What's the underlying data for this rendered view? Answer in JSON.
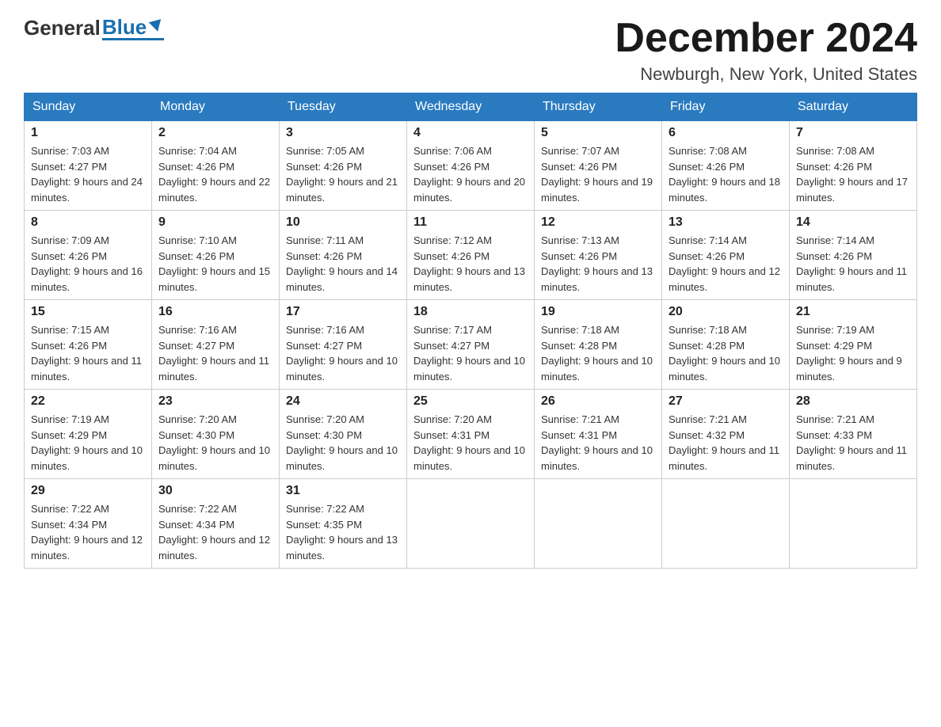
{
  "header": {
    "logo_general": "General",
    "logo_blue": "Blue",
    "title": "December 2024",
    "subtitle": "Newburgh, New York, United States"
  },
  "calendar": {
    "days_of_week": [
      "Sunday",
      "Monday",
      "Tuesday",
      "Wednesday",
      "Thursday",
      "Friday",
      "Saturday"
    ],
    "weeks": [
      [
        {
          "day": "1",
          "sunrise": "Sunrise: 7:03 AM",
          "sunset": "Sunset: 4:27 PM",
          "daylight": "Daylight: 9 hours and 24 minutes."
        },
        {
          "day": "2",
          "sunrise": "Sunrise: 7:04 AM",
          "sunset": "Sunset: 4:26 PM",
          "daylight": "Daylight: 9 hours and 22 minutes."
        },
        {
          "day": "3",
          "sunrise": "Sunrise: 7:05 AM",
          "sunset": "Sunset: 4:26 PM",
          "daylight": "Daylight: 9 hours and 21 minutes."
        },
        {
          "day": "4",
          "sunrise": "Sunrise: 7:06 AM",
          "sunset": "Sunset: 4:26 PM",
          "daylight": "Daylight: 9 hours and 20 minutes."
        },
        {
          "day": "5",
          "sunrise": "Sunrise: 7:07 AM",
          "sunset": "Sunset: 4:26 PM",
          "daylight": "Daylight: 9 hours and 19 minutes."
        },
        {
          "day": "6",
          "sunrise": "Sunrise: 7:08 AM",
          "sunset": "Sunset: 4:26 PM",
          "daylight": "Daylight: 9 hours and 18 minutes."
        },
        {
          "day": "7",
          "sunrise": "Sunrise: 7:08 AM",
          "sunset": "Sunset: 4:26 PM",
          "daylight": "Daylight: 9 hours and 17 minutes."
        }
      ],
      [
        {
          "day": "8",
          "sunrise": "Sunrise: 7:09 AM",
          "sunset": "Sunset: 4:26 PM",
          "daylight": "Daylight: 9 hours and 16 minutes."
        },
        {
          "day": "9",
          "sunrise": "Sunrise: 7:10 AM",
          "sunset": "Sunset: 4:26 PM",
          "daylight": "Daylight: 9 hours and 15 minutes."
        },
        {
          "day": "10",
          "sunrise": "Sunrise: 7:11 AM",
          "sunset": "Sunset: 4:26 PM",
          "daylight": "Daylight: 9 hours and 14 minutes."
        },
        {
          "day": "11",
          "sunrise": "Sunrise: 7:12 AM",
          "sunset": "Sunset: 4:26 PM",
          "daylight": "Daylight: 9 hours and 13 minutes."
        },
        {
          "day": "12",
          "sunrise": "Sunrise: 7:13 AM",
          "sunset": "Sunset: 4:26 PM",
          "daylight": "Daylight: 9 hours and 13 minutes."
        },
        {
          "day": "13",
          "sunrise": "Sunrise: 7:14 AM",
          "sunset": "Sunset: 4:26 PM",
          "daylight": "Daylight: 9 hours and 12 minutes."
        },
        {
          "day": "14",
          "sunrise": "Sunrise: 7:14 AM",
          "sunset": "Sunset: 4:26 PM",
          "daylight": "Daylight: 9 hours and 11 minutes."
        }
      ],
      [
        {
          "day": "15",
          "sunrise": "Sunrise: 7:15 AM",
          "sunset": "Sunset: 4:26 PM",
          "daylight": "Daylight: 9 hours and 11 minutes."
        },
        {
          "day": "16",
          "sunrise": "Sunrise: 7:16 AM",
          "sunset": "Sunset: 4:27 PM",
          "daylight": "Daylight: 9 hours and 11 minutes."
        },
        {
          "day": "17",
          "sunrise": "Sunrise: 7:16 AM",
          "sunset": "Sunset: 4:27 PM",
          "daylight": "Daylight: 9 hours and 10 minutes."
        },
        {
          "day": "18",
          "sunrise": "Sunrise: 7:17 AM",
          "sunset": "Sunset: 4:27 PM",
          "daylight": "Daylight: 9 hours and 10 minutes."
        },
        {
          "day": "19",
          "sunrise": "Sunrise: 7:18 AM",
          "sunset": "Sunset: 4:28 PM",
          "daylight": "Daylight: 9 hours and 10 minutes."
        },
        {
          "day": "20",
          "sunrise": "Sunrise: 7:18 AM",
          "sunset": "Sunset: 4:28 PM",
          "daylight": "Daylight: 9 hours and 10 minutes."
        },
        {
          "day": "21",
          "sunrise": "Sunrise: 7:19 AM",
          "sunset": "Sunset: 4:29 PM",
          "daylight": "Daylight: 9 hours and 9 minutes."
        }
      ],
      [
        {
          "day": "22",
          "sunrise": "Sunrise: 7:19 AM",
          "sunset": "Sunset: 4:29 PM",
          "daylight": "Daylight: 9 hours and 10 minutes."
        },
        {
          "day": "23",
          "sunrise": "Sunrise: 7:20 AM",
          "sunset": "Sunset: 4:30 PM",
          "daylight": "Daylight: 9 hours and 10 minutes."
        },
        {
          "day": "24",
          "sunrise": "Sunrise: 7:20 AM",
          "sunset": "Sunset: 4:30 PM",
          "daylight": "Daylight: 9 hours and 10 minutes."
        },
        {
          "day": "25",
          "sunrise": "Sunrise: 7:20 AM",
          "sunset": "Sunset: 4:31 PM",
          "daylight": "Daylight: 9 hours and 10 minutes."
        },
        {
          "day": "26",
          "sunrise": "Sunrise: 7:21 AM",
          "sunset": "Sunset: 4:31 PM",
          "daylight": "Daylight: 9 hours and 10 minutes."
        },
        {
          "day": "27",
          "sunrise": "Sunrise: 7:21 AM",
          "sunset": "Sunset: 4:32 PM",
          "daylight": "Daylight: 9 hours and 11 minutes."
        },
        {
          "day": "28",
          "sunrise": "Sunrise: 7:21 AM",
          "sunset": "Sunset: 4:33 PM",
          "daylight": "Daylight: 9 hours and 11 minutes."
        }
      ],
      [
        {
          "day": "29",
          "sunrise": "Sunrise: 7:22 AM",
          "sunset": "Sunset: 4:34 PM",
          "daylight": "Daylight: 9 hours and 12 minutes."
        },
        {
          "day": "30",
          "sunrise": "Sunrise: 7:22 AM",
          "sunset": "Sunset: 4:34 PM",
          "daylight": "Daylight: 9 hours and 12 minutes."
        },
        {
          "day": "31",
          "sunrise": "Sunrise: 7:22 AM",
          "sunset": "Sunset: 4:35 PM",
          "daylight": "Daylight: 9 hours and 13 minutes."
        },
        null,
        null,
        null,
        null
      ]
    ]
  }
}
